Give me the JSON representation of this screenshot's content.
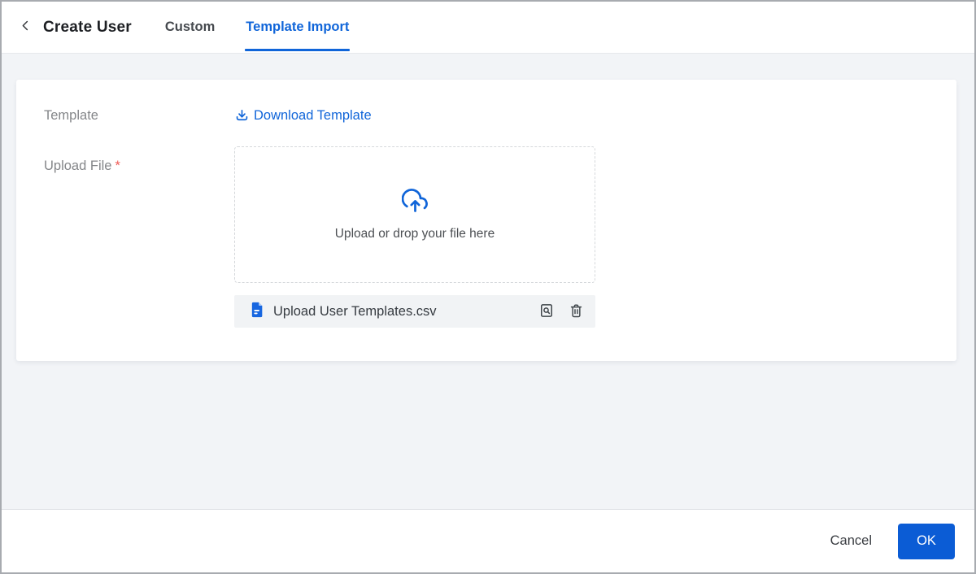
{
  "header": {
    "back_icon": "chevron-left",
    "title": "Create User",
    "tabs": [
      {
        "id": "custom",
        "label": "Custom",
        "active": false
      },
      {
        "id": "template-import",
        "label": "Template Import",
        "active": true
      }
    ]
  },
  "form": {
    "template_label": "Template",
    "download_link_label": "Download Template",
    "download_icon": "download-icon",
    "upload_label": "Upload File",
    "required_marker": "*",
    "dropzone_hint": "Upload or drop your file here",
    "dropzone_icon": "cloud-upload-icon",
    "uploaded_file": {
      "name": "Upload User Templates.csv",
      "file_icon": "csv-document-icon",
      "actions": [
        {
          "id": "preview",
          "icon": "file-search-icon"
        },
        {
          "id": "delete",
          "icon": "trash-icon"
        }
      ]
    }
  },
  "footer": {
    "cancel_label": "Cancel",
    "ok_label": "OK"
  },
  "colors": {
    "accent": "#1065d9",
    "ok_button": "#0b5cd5",
    "required": "#f05b56",
    "page_background": "#f2f4f7",
    "file_row_background": "#f1f3f5"
  }
}
